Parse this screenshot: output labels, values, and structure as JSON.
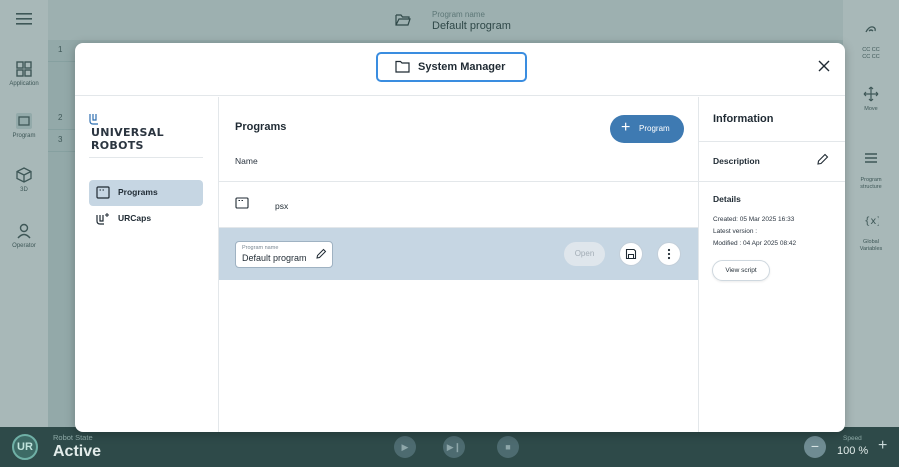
{
  "header": {
    "program_name_label": "Program name",
    "program_name": "Default program"
  },
  "left_rail": {
    "items": [
      {
        "label": "Application",
        "icon": "grid-icon"
      },
      {
        "label": "Program",
        "icon": "program-icon"
      },
      {
        "label": "3D",
        "icon": "cube-icon"
      },
      {
        "label": "Operator",
        "icon": "person-icon"
      }
    ]
  },
  "right_rail": {
    "items": [
      {
        "label": "CC CC\nCC CC",
        "icon": "hand-icon"
      },
      {
        "label": "Move",
        "icon": "move-icon"
      },
      {
        "label": "Program\nstructure",
        "icon": "list-icon"
      },
      {
        "label": "Global\nVariables",
        "icon": "variables-icon"
      }
    ]
  },
  "editor": {
    "line_numbers": [
      "1",
      "2",
      "3"
    ]
  },
  "footer": {
    "robot_state_label": "Robot State",
    "robot_state": "Active",
    "speed_label": "Speed",
    "speed_value": "100 %"
  },
  "modal": {
    "title": "System Manager",
    "brand": "UNIVERSAL ROBOTS",
    "nav": [
      {
        "label": "Programs",
        "icon": "program-icon",
        "active": true
      },
      {
        "label": "URCaps",
        "icon": "urcaps-icon",
        "active": false
      }
    ],
    "programs": {
      "title": "Programs",
      "add_button": "Program",
      "column_name": "Name",
      "files": [
        {
          "name": "psx"
        }
      ],
      "selected": {
        "field_label": "Program name",
        "field_value": "Default program",
        "open_button": "Open"
      }
    },
    "information": {
      "title": "Information",
      "description_label": "Description",
      "details_label": "Details",
      "created": "Created: 05 Mar 2025 16:33",
      "latest_version": "Latest version :",
      "modified": "Modified : 04 Apr 2025 08:42",
      "view_script_button": "View script"
    }
  },
  "colors": {
    "accent": "#3e7ab2",
    "selection": "#c6d6e3",
    "focus_border": "#3a8de0",
    "footer_bg": "#2e4a49"
  }
}
